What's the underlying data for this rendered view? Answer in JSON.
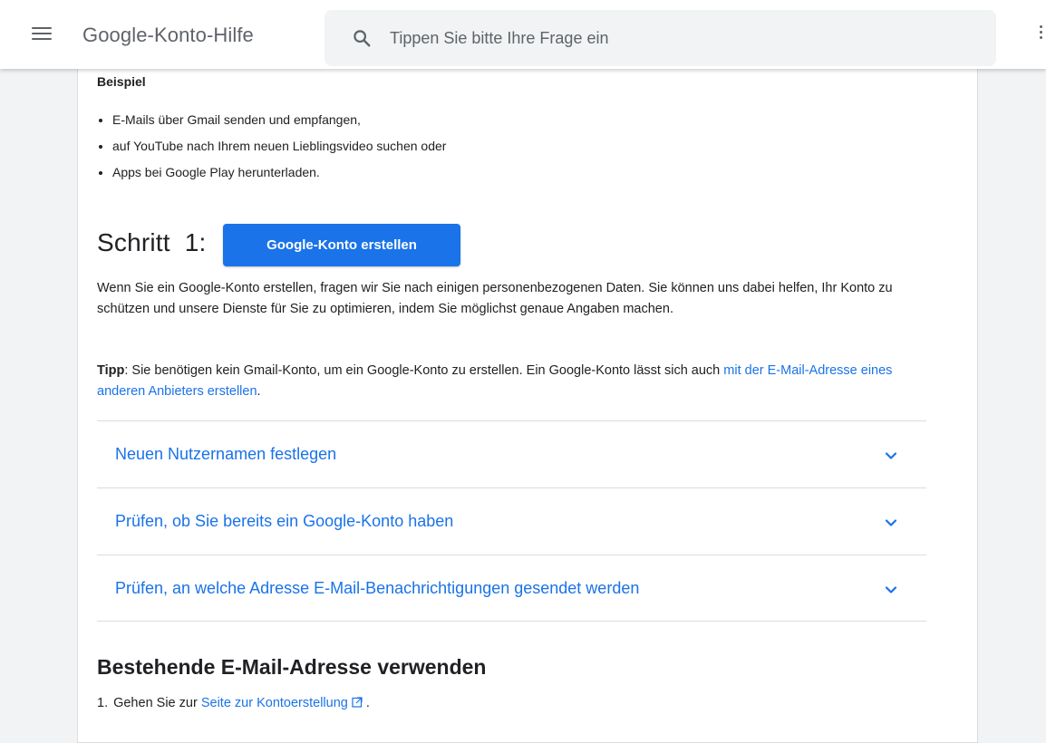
{
  "header": {
    "title": "Google-Konto-Hilfe",
    "search_placeholder": "Tippen Sie bitte Ihre Frage ein",
    "menu_icon": "hamburger-menu-icon",
    "search_icon": "search-icon"
  },
  "article": {
    "partial_heading": "Beispiel",
    "examples": [
      "E-Mails über Gmail senden und empfangen,",
      "auf YouTube nach Ihrem neuen Lieblingsvideo suchen oder",
      "Apps bei Google Play herunterladen."
    ],
    "step_heading": "Schritt  1:",
    "create_button_label": "Google-Konto erstellen",
    "paragraph1": "Wenn Sie ein Google-Konto erstellen, fragen wir Sie nach einigen personenbezogenen Daten. Sie können uns dabei helfen, Ihr Konto zu schützen und unsere Dienste für Sie zu optimieren, indem Sie möglichst genaue Angaben machen.",
    "tip_label": "Tipp",
    "tip_text": ": Sie benötigen kein Gmail-Konto, um ein Google-Konto zu erstellen. Ein Google-Konto lässt sich auch ",
    "tip_link": "mit der E-Mail-Adresse eines anderen Anbieters erstellen",
    "tip_end": ".",
    "accordion": [
      "Neuen Nutzernamen festlegen",
      "Prüfen, ob Sie bereits ein Google-Konto haben",
      "Prüfen, an welche Adresse E-Mail-Benachrichtigungen gesendet werden"
    ],
    "section_title": "Bestehende E-Mail-Adresse verwenden",
    "step1_number": "1.",
    "step1_text": "Gehen Sie zur ",
    "step1_link": "Seite zur Kontoerstellung",
    "step1_end": " ."
  },
  "colors": {
    "accent": "#1a73e8",
    "text": "#202124",
    "muted": "#5f6368",
    "divider": "#dadce0"
  }
}
